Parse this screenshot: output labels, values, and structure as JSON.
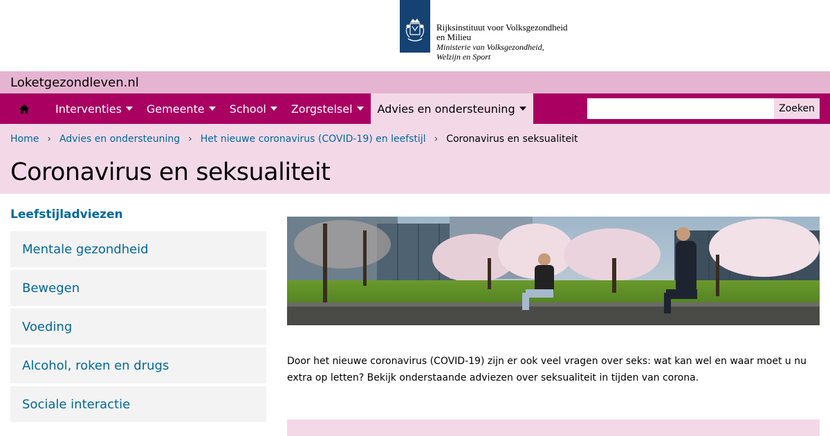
{
  "header": {
    "logo_line1": "Rijksinstituut voor Volksgezondheid",
    "logo_line2": "en Milieu",
    "logo_sub1": "Ministerie van Volksgezondheid,",
    "logo_sub2": "Welzijn en Sport",
    "logo_icon": "crest-icon"
  },
  "site": {
    "name": "Loketgezondleven.nl"
  },
  "nav": {
    "home_icon": "home-icon",
    "items": [
      {
        "label": "Interventies"
      },
      {
        "label": "Gemeente"
      },
      {
        "label": "School"
      },
      {
        "label": "Zorgstelsel"
      },
      {
        "label": "Advies en ondersteuning"
      }
    ],
    "search_value": "",
    "search_button": "Zoeken"
  },
  "breadcrumb": {
    "items": [
      "Home",
      "Advies en ondersteuning",
      "Het nieuwe coronavirus (COVID-19) en leefstijl"
    ],
    "separator": "›",
    "current": "Coronavirus en seksualiteit"
  },
  "page": {
    "title": "Coronavirus en seksualiteit"
  },
  "sidebar": {
    "title": "Leefstijladviezen",
    "items": [
      {
        "label": "Mentale gezondheid"
      },
      {
        "label": "Bewegen"
      },
      {
        "label": "Voeding"
      },
      {
        "label": "Alcohol, roken en drugs"
      },
      {
        "label": "Sociale interactie"
      }
    ]
  },
  "main": {
    "intro": "Door het nieuwe coronavirus (COVID-19) zijn er ook veel vragen over seks: wat kan wel en waar moet u nu extra op letten? Bekijk onderstaande adviezen over seksualiteit in tijden van corona."
  },
  "colors": {
    "brand": "#a90061",
    "site_bar": "#e5b4d1",
    "light_pink": "#f3d9e8",
    "link": "#01689b",
    "logo_blue": "#154273"
  }
}
